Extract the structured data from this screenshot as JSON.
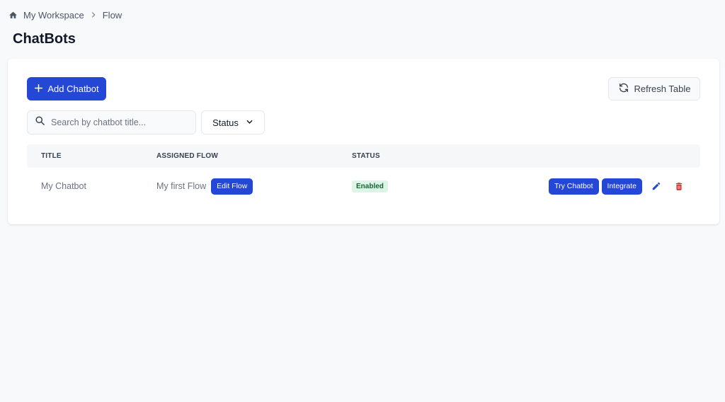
{
  "breadcrumb": {
    "items": [
      {
        "label": "My Workspace"
      },
      {
        "label": "Flow"
      }
    ]
  },
  "page": {
    "title": "ChatBots"
  },
  "toolbar": {
    "add_label": "Add Chatbot",
    "refresh_label": "Refresh Table"
  },
  "filters": {
    "search_placeholder": "Search by chatbot title...",
    "status_label": "Status"
  },
  "table": {
    "headers": [
      "TITLE",
      "ASSIGNED FLOW",
      "STATUS"
    ],
    "rows": [
      {
        "title": "My Chatbot",
        "flow": "My first Flow",
        "edit_flow_label": "Edit Flow",
        "status": "Enabled",
        "try_label": "Try Chatbot",
        "integrate_label": "Integrate"
      }
    ]
  },
  "colors": {
    "primary": "#2447d6",
    "badge_bg": "#dcf5e6",
    "badge_text": "#166534",
    "danger": "#dc2626"
  },
  "icons": [
    "home-icon",
    "chevron-right-icon",
    "plus-icon",
    "refresh-icon",
    "search-icon",
    "chevron-down-icon",
    "pencil-icon",
    "trash-icon"
  ]
}
